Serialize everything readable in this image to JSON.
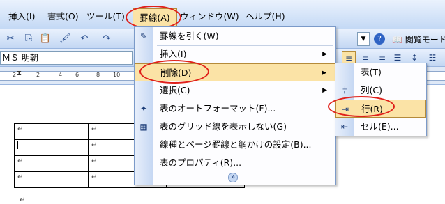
{
  "menubar": {
    "items": [
      {
        "label": "挿入(I)"
      },
      {
        "label": "書式(O)"
      },
      {
        "label": "ツール(T)"
      },
      {
        "label": "罫線(A)"
      },
      {
        "label": "ウィンドウ(W)"
      },
      {
        "label": "ヘルプ(H)"
      }
    ]
  },
  "toolbar": {
    "read_mode_label": "閲覧モード",
    "help_icon": "?"
  },
  "formatbar": {
    "font_name": "ＭＳ 明朝"
  },
  "ruler": {
    "numbers": [
      "2",
      "2",
      "4",
      "6",
      "8",
      "10"
    ]
  },
  "document": {
    "cell_mark": "↵"
  },
  "ruled_menu": {
    "items": [
      {
        "label": "罫線を引く(W)",
        "icon": "pencil-icon"
      },
      {
        "label": "挿入(I)",
        "has_submenu": true
      },
      {
        "label": "削除(D)",
        "has_submenu": true,
        "highlighted": true
      },
      {
        "label": "選択(C)",
        "has_submenu": true
      },
      {
        "label": "表のオートフォーマット(F)...",
        "icon": "autoformat-icon"
      },
      {
        "label": "表のグリッド線を表示しない(G)",
        "icon": "grid-icon"
      },
      {
        "label": "線種とページ罫線と網かけの設定(B)..."
      },
      {
        "label": "表のプロパティ(R)..."
      }
    ],
    "expand_glyph": "»"
  },
  "delete_submenu": {
    "items": [
      {
        "label": "表(T)",
        "icon": "table-delete-icon"
      },
      {
        "label": "列(C)",
        "icon": "column-delete-icon"
      },
      {
        "label": "行(R)",
        "icon": "row-delete-icon",
        "highlighted": true
      },
      {
        "label": "セル(E)...",
        "icon": "cell-delete-icon"
      }
    ]
  },
  "colors": {
    "highlight": "#fbe3a6",
    "annotation": "#e0201a",
    "menubar": "#c4d9f5"
  }
}
